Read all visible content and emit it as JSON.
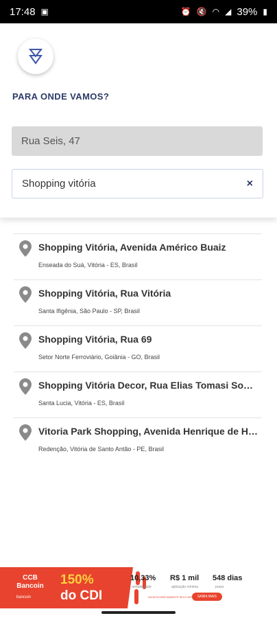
{
  "status_bar": {
    "time": "17:48",
    "battery": "39%"
  },
  "header": {
    "title": "PARA ONDE VAMOS?"
  },
  "origin": {
    "value": "Rua Seis, 47"
  },
  "destination": {
    "value": "Shopping vitória",
    "clear_label": "×"
  },
  "results": [
    {
      "title": "Shopping Vitória, Avenida Américo Buaiz",
      "subtitle": "Enseada do Suá, Vitória - ES, Brasil"
    },
    {
      "title": "Shopping Vitória, Rua Vitória",
      "subtitle": "Santa Ifigênia, São Paulo - SP, Brasil"
    },
    {
      "title": "Shopping Vitória, Rua 69",
      "subtitle": "Setor Norte Ferroviário, Goiânia - GO, Brasil"
    },
    {
      "title": "Shopping Vitória Decor, Rua Elias Tomasi Sobrinho",
      "subtitle": "Santa Lucia, Vitória - ES, Brasil"
    },
    {
      "title": "Vitoria Park Shopping, Avenida Henrique de Holanda",
      "subtitle": "Redenção, Vitória de Santo Antão - PE, Brasil"
    }
  ],
  "ad": {
    "bank": "CCB Bancoin",
    "bank_small": "bancoin",
    "rate": "150%",
    "rate_label": "do CDI",
    "stat1": "10,33%",
    "stat1_sub": "rentabilidade",
    "stat2": "R$ 1 mil",
    "stat2_sub": "aplicação mínima",
    "stat3": "548 dias",
    "stat3_sub": "prazo",
    "mini_text": "INVISTA DIRETAMENTE PELO APP BANCOIN",
    "cta": "SAIBA MAIS",
    "accent_color": "#e8432e",
    "highlight_color": "#ffd23f"
  },
  "colors": {
    "brand": "#2b3a66",
    "pin": "#8a8a8a",
    "origin_bg": "#d9d9d9"
  }
}
